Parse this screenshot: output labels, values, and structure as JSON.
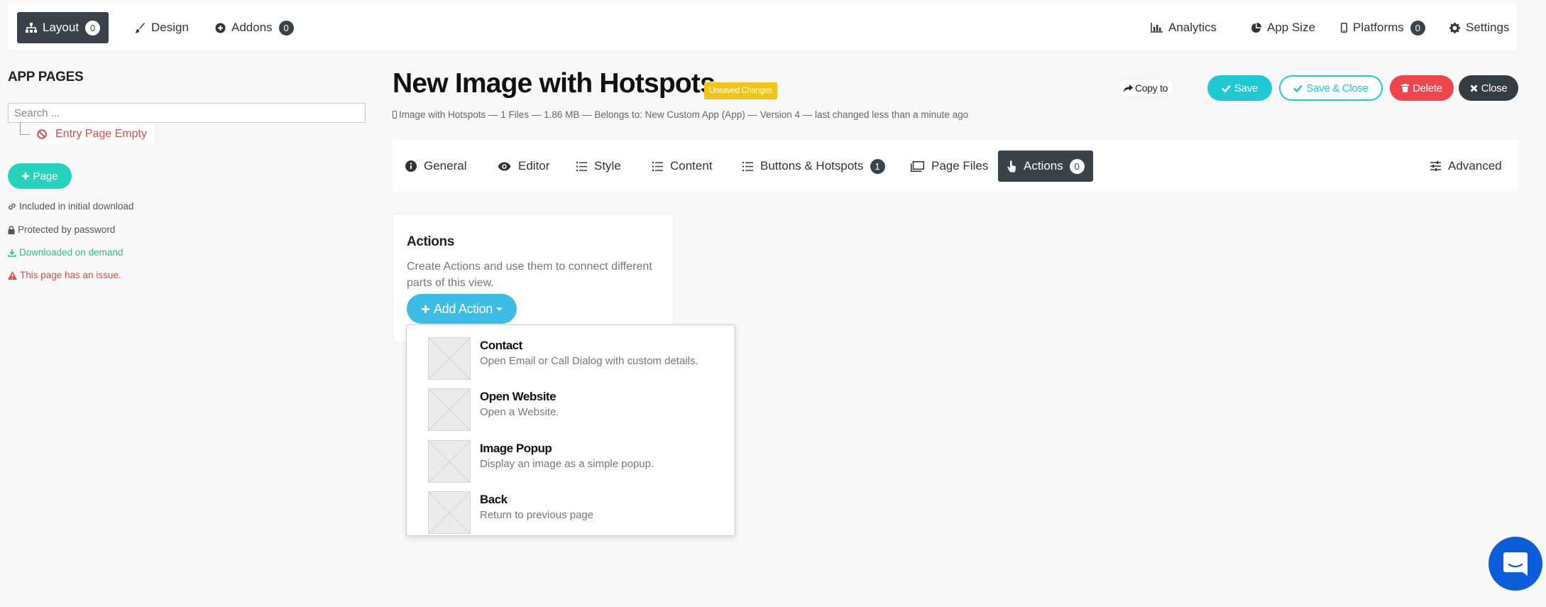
{
  "topnav": {
    "layout": {
      "label": "Layout",
      "badge": "0",
      "icon": "sitemap-icon"
    },
    "design": {
      "label": "Design",
      "icon": "brush-icon"
    },
    "addons": {
      "label": "Addons",
      "badge": "0",
      "icon": "plus-circle-icon"
    },
    "analytics": {
      "label": "Analytics",
      "icon": "bar-chart-icon"
    },
    "appsize": {
      "label": "App Size",
      "icon": "pie-chart-icon"
    },
    "platforms": {
      "label": "Platforms",
      "badge": "0",
      "icon": "mobile-icon"
    },
    "settings": {
      "label": "Settings",
      "icon": "gear-icon"
    }
  },
  "sidebar": {
    "title": "APP PAGES",
    "search_placeholder": "Search ...",
    "entry_page": "Entry Page Empty",
    "add_page": "Page",
    "legend": {
      "included": "Included in initial download",
      "protected": "Protected by password",
      "downloaded": "Downloaded on demand",
      "issue": "This page has an issue."
    }
  },
  "header": {
    "title": "New Image with Hotspots",
    "unsaved": "Unsaved Changes",
    "meta": "Image with Hotspots — 1 Files — 1.86 MB — Belongs to: New Custom App (App) — Version 4 — last changed less than a minute ago",
    "copy_to": "Copy to",
    "save": "Save",
    "save_close": "Save & Close",
    "delete": "Delete",
    "close": "Close"
  },
  "tabs": {
    "general": "General",
    "editor": "Editor",
    "style": "Style",
    "content": "Content",
    "buttons": "Buttons & Hotspots",
    "buttons_badge": "1",
    "files": "Page Files",
    "actions": "Actions",
    "actions_badge": "0",
    "advanced": "Advanced"
  },
  "actions_panel": {
    "title": "Actions",
    "description": "Create Actions and use them to connect different parts of this view.",
    "add_action": "Add Action"
  },
  "dropdown": [
    {
      "title": "Contact",
      "desc": "Open Email or Call Dialog with custom details."
    },
    {
      "title": "Open Website",
      "desc": "Open a Website."
    },
    {
      "title": "Image Popup",
      "desc": "Display an image as a simple popup."
    },
    {
      "title": "Back",
      "desc": "Return to previous page"
    }
  ],
  "colors": {
    "dark": "#3a434a",
    "teal": "#26d3bc",
    "cyan": "#1ec9d4",
    "red": "#f0454b",
    "yellow": "#f0c419",
    "blue": "#3bbde6",
    "chat": "#0b5ed7"
  }
}
